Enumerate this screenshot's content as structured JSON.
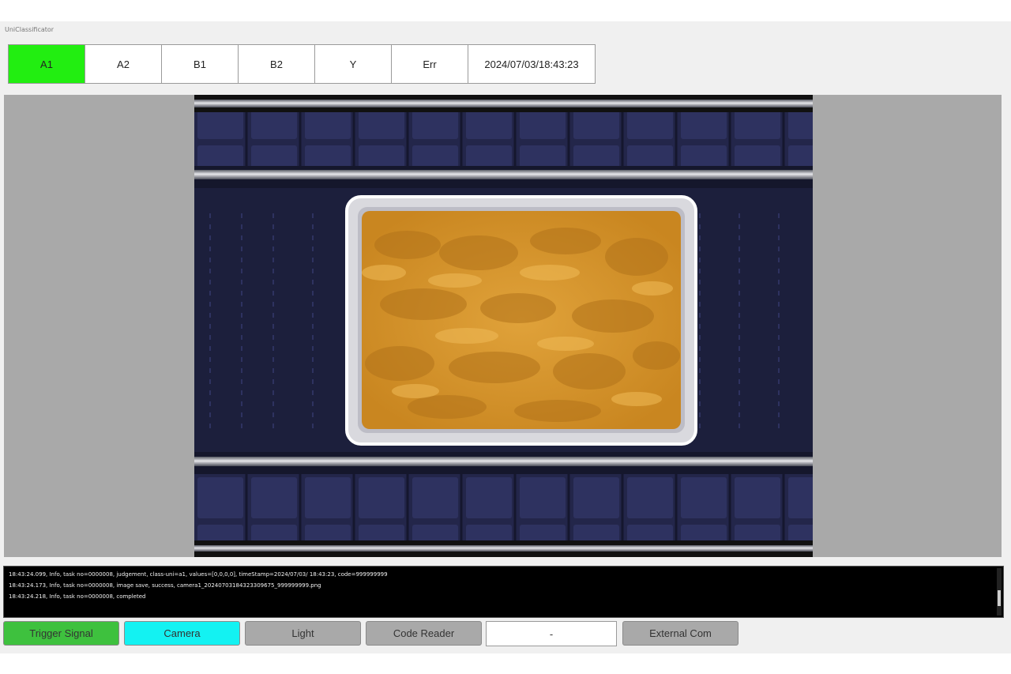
{
  "window": {
    "title": "UniClassificator"
  },
  "classes": {
    "items": [
      {
        "label": "A1",
        "active": true
      },
      {
        "label": "A2",
        "active": false
      },
      {
        "label": "B1",
        "active": false
      },
      {
        "label": "B2",
        "active": false
      },
      {
        "label": "Y",
        "active": false
      },
      {
        "label": "Err",
        "active": false
      }
    ],
    "timestamp": "2024/07/03/18:43:23",
    "active_color": "#22ee11"
  },
  "log": {
    "lines": [
      "18:43:24.099, Info, task no=0000008, judgement, class-uni=a1, values=[0,0,0,0], timeStamp=2024/07/03/ 18:43:23, code=999999999",
      "18:43:24.173, Info, task no=0000008, image save, success, camera1_20240703184323309675_999999999.png",
      "18:43:24.218, Info, task no=0000008, completed"
    ]
  },
  "status_buttons": {
    "trigger": {
      "label": "Trigger Signal",
      "color": "#3ec13e"
    },
    "camera": {
      "label": "Camera",
      "color": "#13f2f2"
    },
    "light": {
      "label": "Light",
      "color": "#a9a9a9"
    },
    "code_reader": {
      "label": "Code Reader",
      "color": "#a9a9a9"
    },
    "code_value": {
      "label": "-"
    },
    "external": {
      "label": "External Com",
      "color": "#a9a9a9"
    }
  }
}
